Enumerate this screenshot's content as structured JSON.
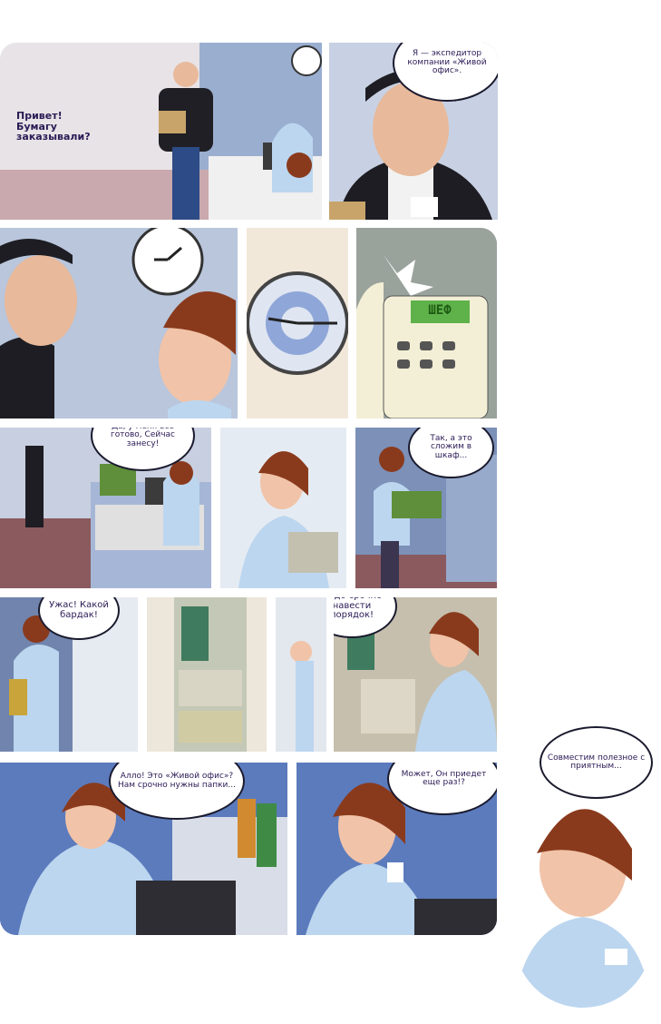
{
  "panels": [
    {
      "id": "p1",
      "speech": "Привет! Бумагу заказывали?"
    },
    {
      "id": "p2",
      "speech": "Я — экспедитор компании «Живой офис»."
    },
    {
      "id": "p3",
      "speech": ""
    },
    {
      "id": "p4",
      "speech": ""
    },
    {
      "id": "p5",
      "speech": "",
      "display": "ШЕФ"
    },
    {
      "id": "p6",
      "speech": "Да, у меня все готово, Сейчас занесу!"
    },
    {
      "id": "p7",
      "speech": ""
    },
    {
      "id": "p8",
      "speech": "Так, а это сложим в шкаф..."
    },
    {
      "id": "p9",
      "speech": "Ужас! Какой бардак!"
    },
    {
      "id": "p10",
      "speech": "Надо срочно навести порядок!"
    },
    {
      "id": "p11",
      "speech": "Алло! Это «Живой офис»? Нам срочно нужны папки..."
    },
    {
      "id": "p12",
      "speech": "Может, Он приедет еще раз!?"
    },
    {
      "id": "p13",
      "speech": "Совместим полезное с приятным..."
    }
  ],
  "colors": {
    "ink": "#1a1a2e",
    "text": "#2a1a55",
    "wall": "#b9c6dc",
    "floor": "#8a5a5e",
    "shirt": "#bcd6ef",
    "hair": "#8a3a1c"
  }
}
